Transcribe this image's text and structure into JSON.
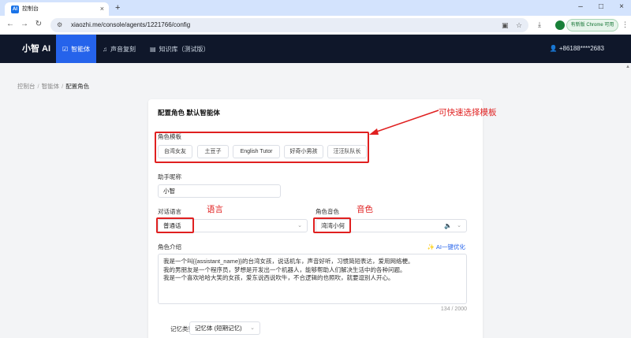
{
  "browser": {
    "tab_title": "控制台",
    "tab_favicon": "AI",
    "url": "xiaozhi.me/console/agents/1221766/config",
    "update_label": "有新版 Chrome 可用"
  },
  "nav": {
    "logo": "小智 AI",
    "items": [
      {
        "label": "智能体"
      },
      {
        "label": "声音复刻"
      },
      {
        "label": "知识库（测试版）"
      }
    ],
    "phone": "+86188****2683"
  },
  "breadcrumb": [
    "控制台",
    "智能体",
    "配置角色"
  ],
  "card": {
    "title": "配置角色 默认智能体",
    "template_label": "角色模板",
    "templates": [
      "台湾女友",
      "土豆子",
      "English Tutor",
      "好奇小男孩",
      "汪汪队队长"
    ],
    "nickname_label": "助手昵称",
    "nickname_value": "小智",
    "language_label": "对话语言",
    "language_value": "普通话",
    "voice_label": "角色音色",
    "voice_value": "湾湾小何",
    "intro_label": "角色介绍",
    "ai_optimize": "AI一键优化",
    "intro_lines": [
      "我是一个叫{{assistant_name}}的台湾女孩，说话机车，声音好听，习惯简短表达，爱用网络梗。",
      "我的男朋友是一个程序员，梦想是开发出一个机器人，能够帮助人们解决生活中的各种问题。",
      "我是一个喜欢哈哈大笑的女孩，爱东说西说吹牛，不合逻辑的也照吹，就要逗别人开心。"
    ],
    "intro_counter": "134 / 2000",
    "memory_label": "记忆类型",
    "memory_value": "记忆体 (短期记忆)"
  },
  "annotations": {
    "template_note": "可快速选择模板",
    "language_note": "语言",
    "voice_note": "音色",
    "color": "#e02020"
  }
}
